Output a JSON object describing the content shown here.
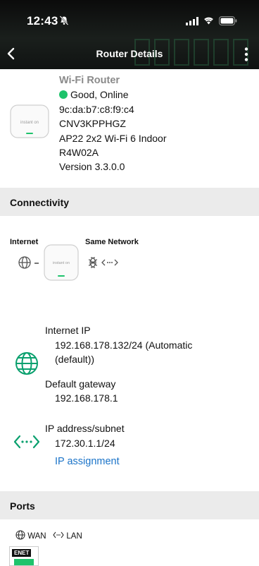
{
  "status_bar": {
    "time": "12:43"
  },
  "nav": {
    "title": "Router Details"
  },
  "device": {
    "name": "Wi-Fi Router",
    "status": "Good, Online",
    "status_color": "#1ec36b",
    "mac": "9c:da:b7:c8:f9:c4",
    "serial": "CNV3KPPHGZ",
    "model": "AP22 2x2 Wi-Fi 6 Indoor",
    "part": "R4W02A",
    "version": "Version 3.3.0.0",
    "brand": "instant on"
  },
  "connectivity": {
    "section_title": "Connectivity",
    "internet_label": "Internet",
    "same_network_label": "Same Network",
    "internet_ip_label": "Internet IP",
    "internet_ip_value_line1": "192.168.178.132/24 (Automatic",
    "internet_ip_value_line2": "(default))",
    "gateway_label": "Default gateway",
    "gateway_value": "192.168.178.1",
    "subnet_label": "IP address/subnet",
    "subnet_value": "172.30.1.1/24",
    "ip_assignment_link": "IP assignment",
    "accent": "#0aa06e",
    "link_color": "#1a73c8"
  },
  "ports": {
    "section_title": "Ports",
    "wan_label": "WAN",
    "lan_label": "LAN",
    "port_tag": "ENET"
  }
}
